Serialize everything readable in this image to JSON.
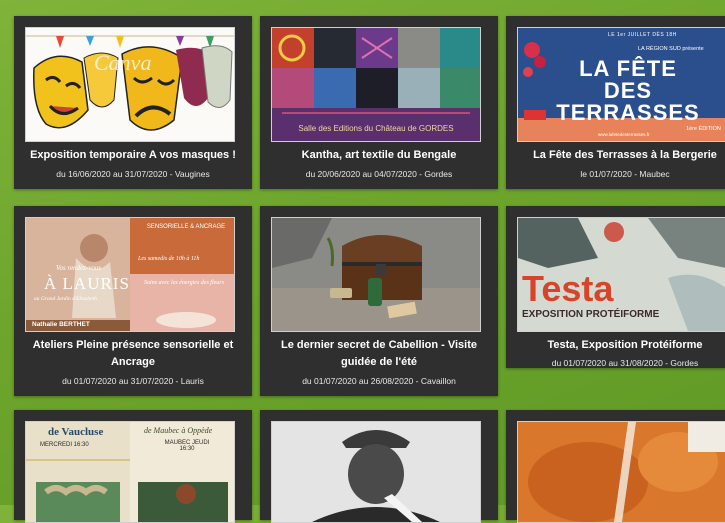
{
  "events": [
    {
      "title": "Exposition temporaire A vos masques !",
      "meta": "du 16/06/2020 au 31/07/2020 - Vaugines",
      "image": "masks-illustration",
      "overlay": "Canva"
    },
    {
      "title": "Kantha, art textile du Bengale",
      "meta": "du 20/06/2020 au 04/07/2020 - Gordes",
      "image": "textile-patchwork",
      "overlay": "Salle des Editions du Château de GORDES"
    },
    {
      "title": "La Fête des Terrasses à la Bergerie",
      "meta": "le 01/07/2020 - Maubec",
      "image": "festival-poster",
      "overlay_top": "LE 1er JUILLET DÈS 18H",
      "overlay_main": "LA FÊTE DES TERRASSES",
      "overlay_small": "LA RÉGION SUD présente",
      "overlay_edition": "1ère ÉDITION",
      "overlay_url": "www.lafetedesterrasses.fr"
    },
    {
      "title": "Ateliers Pleine présence sensorielle et Ancrage",
      "meta": "du 01/07/2020 au 31/07/2020 - Lauris",
      "image": "wellness-collage",
      "overlay_a": "Vos rendez-vous",
      "overlay_b": "À LAURIS",
      "overlay_c": "au Grand Jardin d'Elisabeth",
      "overlay_d": "SENSORIELLE & ANCRAGE",
      "overlay_e": "Les samedis de 10h à 11h",
      "overlay_f": "Soins avec les énergies des fleurs",
      "overlay_g": "Nathalie BERTHET"
    },
    {
      "title": "Le dernier secret de Cabellion - Visite guidée de l'été",
      "meta": "du 01/07/2020 au 26/08/2020 - Cavaillon",
      "image": "treasure-chest-photo"
    },
    {
      "title": "Testa, Exposition Protéiforme",
      "meta": "du 01/07/2020 au 31/08/2020 - Gordes",
      "image": "testa-poster",
      "overlay_main": "Testa",
      "overlay_sub": "EXPOSITION PROTÉIFORME"
    },
    {
      "title": "",
      "meta": "",
      "image": "vaucluse-poster",
      "overlay_a": "de Vaucluse",
      "overlay_b": "de Maubec à Oppède",
      "overlay_c": "MERCREDI 16:30",
      "overlay_d": "MAUBEC JEUDI 16:30"
    },
    {
      "title": "",
      "meta": "",
      "image": "portrait-bw"
    },
    {
      "title": "",
      "meta": "",
      "image": "spices-photo"
    }
  ]
}
